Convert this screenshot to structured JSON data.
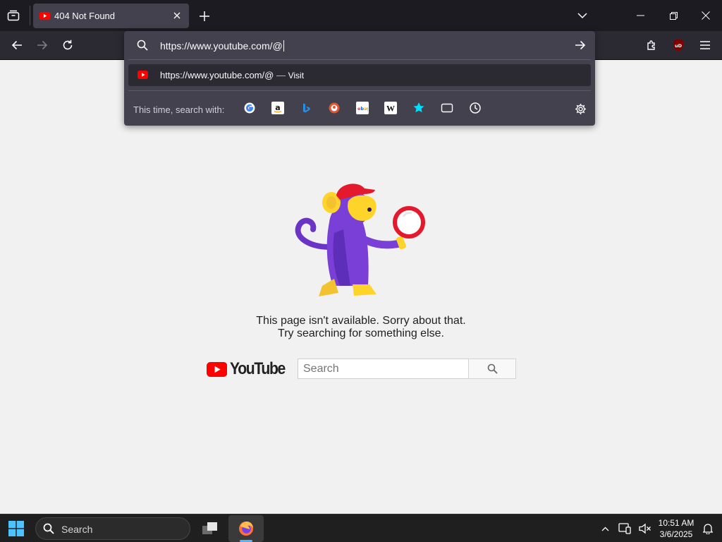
{
  "browser": {
    "tab": {
      "title": "404 Not Found"
    },
    "url_bar": {
      "value": "https://www.youtube.com/@"
    },
    "suggestion": {
      "url": "https://www.youtube.com/@",
      "separator": "—",
      "action": "Visit"
    },
    "one_off": {
      "label": "This time, search with:",
      "engines": [
        "Google",
        "Amazon",
        "Bing",
        "DuckDuckGo",
        "eBay",
        "Wikipedia",
        "Bookmarks",
        "Tabs",
        "History"
      ]
    },
    "extension_badge": "uD",
    "icons": [
      "tab-list-icon",
      "new-tab-icon",
      "list-all-tabs-icon",
      "minimize-icon",
      "restore-icon",
      "close-window-icon",
      "back-icon",
      "forward-icon",
      "reload-icon",
      "extensions-icon",
      "ublock-icon",
      "menu-icon",
      "search-icon",
      "go-arrow-icon",
      "settings-gear-icon"
    ]
  },
  "page": {
    "message_line1": "This page isn't available. Sorry about that.",
    "message_line2": "Try searching for something else.",
    "logo_text": "YouTube",
    "search_placeholder": "Search",
    "colors": {
      "youtube_red": "#ff0000",
      "monkey_purple": "#7a3fd6",
      "monkey_yellow": "#ffd42a",
      "hat_red": "#e5192d"
    }
  },
  "taskbar": {
    "search_label": "Search",
    "time": "10:51 AM",
    "date": "3/6/2025"
  }
}
